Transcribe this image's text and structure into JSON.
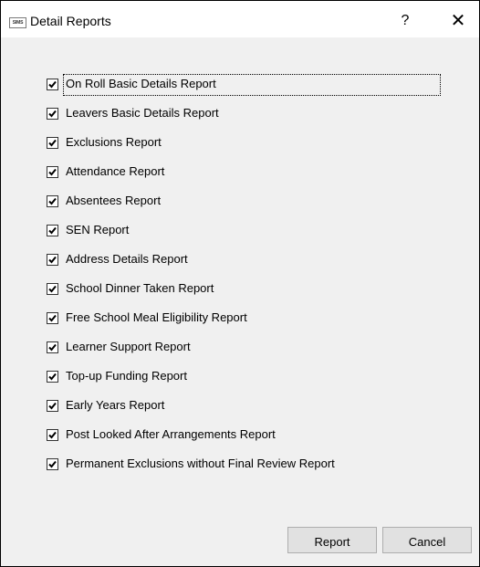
{
  "window": {
    "icon_text": "SIMS",
    "title": "Detail Reports",
    "help_label": "?",
    "close_label": "✕"
  },
  "reports": [
    {
      "label": "On Roll Basic Details Report",
      "checked": true
    },
    {
      "label": "Leavers Basic Details Report",
      "checked": true
    },
    {
      "label": "Exclusions Report",
      "checked": true
    },
    {
      "label": "Attendance Report",
      "checked": true
    },
    {
      "label": "Absentees Report",
      "checked": true
    },
    {
      "label": "SEN Report",
      "checked": true
    },
    {
      "label": "Address Details Report",
      "checked": true
    },
    {
      "label": "School Dinner Taken Report",
      "checked": true
    },
    {
      "label": "Free School Meal Eligibility Report",
      "checked": true
    },
    {
      "label": "Learner Support Report",
      "checked": true
    },
    {
      "label": "Top-up Funding Report",
      "checked": true
    },
    {
      "label": "Early Years Report",
      "checked": true
    },
    {
      "label": "Post Looked After Arrangements Report",
      "checked": true
    },
    {
      "label": "Permanent Exclusions without Final Review Report",
      "checked": true
    }
  ],
  "buttons": {
    "report": "Report",
    "cancel": "Cancel"
  }
}
